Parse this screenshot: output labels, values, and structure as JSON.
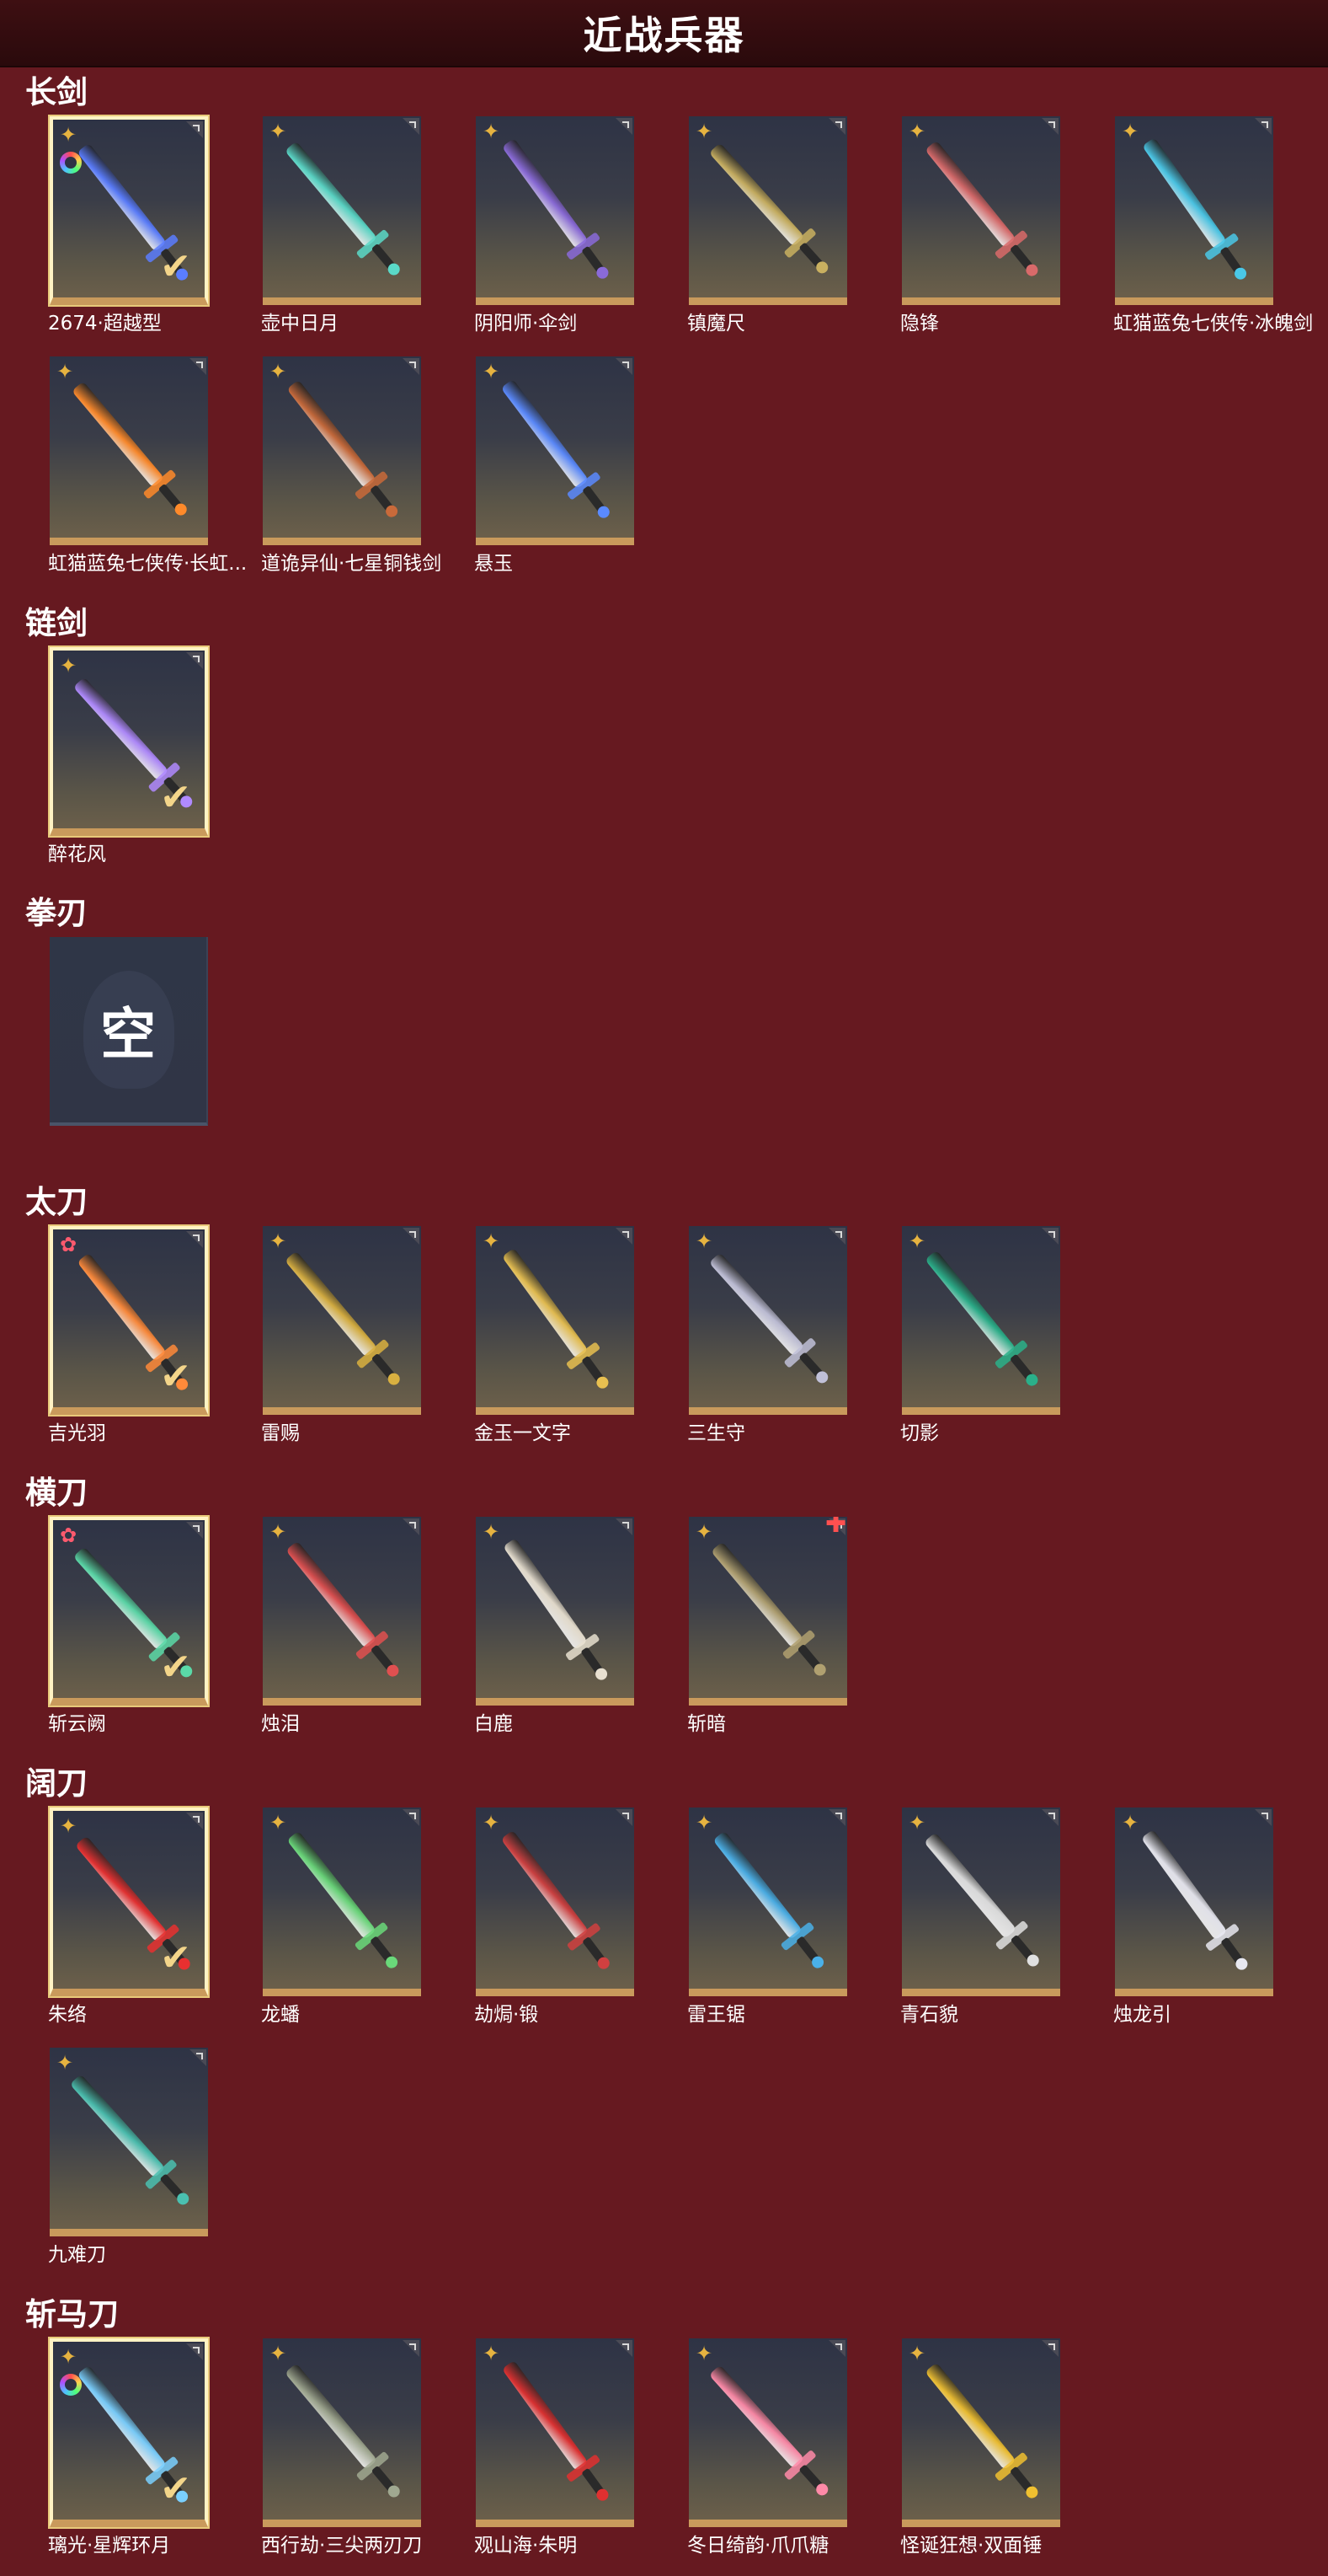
{
  "page_title": "近战兵器",
  "colors": {
    "background": "#661920",
    "header": "#2a0a0c",
    "accent": "#c99a5c",
    "rarity_gold": "#e6b340",
    "rarity_red": "#ff5a6e"
  },
  "sections": [
    {
      "title": "长剑",
      "items": [
        {
          "name": "2674·超越型",
          "selected": true,
          "badge": "star",
          "ring": true,
          "hue": "#5a7dff"
        },
        {
          "name": "壶中日月",
          "selected": false,
          "badge": "star",
          "hue": "#5ad9c8"
        },
        {
          "name": "阴阳师·伞剑",
          "selected": false,
          "badge": "star",
          "hue": "#8a6ad9"
        },
        {
          "name": "镇魔尺",
          "selected": false,
          "badge": "star",
          "hue": "#c9b060"
        },
        {
          "name": "隐锋",
          "selected": false,
          "badge": "star",
          "hue": "#d96a6a"
        },
        {
          "name": "虹猫蓝兔七侠传·冰魄剑",
          "selected": false,
          "badge": "star",
          "hue": "#4ac8e8"
        },
        {
          "name": "虹猫蓝兔七侠传·长虹剑",
          "display": "虹猫蓝兔七侠传·长虹...",
          "selected": false,
          "badge": "star",
          "hue": "#ff8a2a"
        },
        {
          "name": "道诡异仙·七星铜钱剑",
          "selected": false,
          "badge": "star",
          "hue": "#c96a3a"
        },
        {
          "name": "悬玉",
          "selected": false,
          "badge": "star",
          "hue": "#5a8aff"
        }
      ]
    },
    {
      "title": "链剑",
      "items": [
        {
          "name": "醉花风",
          "selected": true,
          "badge": "star",
          "hue": "#b08aff"
        }
      ]
    },
    {
      "title": "拳刃",
      "items": [
        {
          "name": "",
          "empty": true,
          "empty_text": "空"
        }
      ]
    },
    {
      "title": "太刀",
      "items": [
        {
          "name": "吉光羽",
          "selected": true,
          "badge": "red-star",
          "hue": "#ff8a3a"
        },
        {
          "name": "雷赐",
          "selected": false,
          "badge": "star",
          "hue": "#d9b040"
        },
        {
          "name": "金玉一文字",
          "selected": false,
          "badge": "star",
          "hue": "#e8c050"
        },
        {
          "name": "三生守",
          "selected": false,
          "badge": "star",
          "hue": "#c0c0d8"
        },
        {
          "name": "切影",
          "selected": false,
          "badge": "star",
          "hue": "#2ab08a"
        }
      ]
    },
    {
      "title": "横刀",
      "items": [
        {
          "name": "斩云阙",
          "selected": true,
          "badge": "red-star",
          "hue": "#5ad9a8"
        },
        {
          "name": "烛泪",
          "selected": false,
          "badge": "star",
          "hue": "#e05050"
        },
        {
          "name": "白鹿",
          "selected": false,
          "badge": "star",
          "hue": "#e8e0d0"
        },
        {
          "name": "斩暗",
          "selected": false,
          "badge": "star",
          "plus": true,
          "hue": "#b0a070"
        }
      ]
    },
    {
      "title": "阔刀",
      "items": [
        {
          "name": "朱络",
          "selected": true,
          "badge": "star",
          "hue": "#e83030"
        },
        {
          "name": "龙蟠",
          "selected": false,
          "badge": "star",
          "hue": "#6ad97a"
        },
        {
          "name": "劫焗·锻",
          "selected": false,
          "badge": "star",
          "hue": "#d04040"
        },
        {
          "name": "雷王锯",
          "selected": false,
          "badge": "star",
          "hue": "#4ab0e8"
        },
        {
          "name": "青石貌",
          "selected": false,
          "badge": "star",
          "hue": "#e0e0e0"
        },
        {
          "name": "烛龙引",
          "selected": false,
          "badge": "star",
          "hue": "#e8e8f0"
        },
        {
          "name": "九难刀",
          "selected": false,
          "badge": "star",
          "hue": "#4ac0b0"
        }
      ]
    },
    {
      "title": "斩马刀",
      "items": [
        {
          "name": "璃光·星辉环月",
          "selected": true,
          "badge": "star",
          "ring": true,
          "hue": "#7ad0ff"
        },
        {
          "name": "西行劫·三尖两刃刀",
          "selected": false,
          "badge": "star",
          "hue": "#a0a890"
        },
        {
          "name": "观山海·朱明",
          "selected": false,
          "badge": "star",
          "hue": "#e03030"
        },
        {
          "name": "冬日绮韵·爪爪糖",
          "selected": false,
          "badge": "star",
          "hue": "#ff8aa8"
        },
        {
          "name": "怪诞狂想·双面锤",
          "selected": false,
          "badge": "star",
          "hue": "#f0c030"
        }
      ]
    }
  ]
}
